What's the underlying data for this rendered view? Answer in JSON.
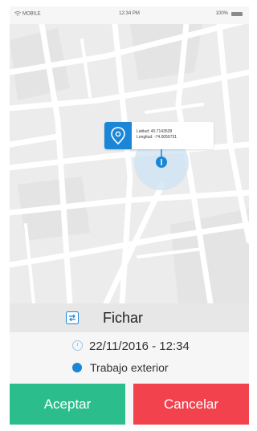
{
  "status_bar": {
    "carrier": "MOBILE",
    "time": "12:34 PM",
    "battery": "100%"
  },
  "map": {
    "latitude_label": "Latitud: 40.7143528",
    "longitude_label": "Longitud: -74.0059731",
    "accent_color": "#1b86d6"
  },
  "fichar": {
    "label": "Fichar",
    "icon": "swap-icon"
  },
  "details": {
    "datetime": "22/11/2016 - 12:34",
    "work_type": "Trabajo exterior"
  },
  "buttons": {
    "accept": "Aceptar",
    "cancel": "Cancelar",
    "accept_color": "#2bbd8c",
    "cancel_color": "#f2424e"
  }
}
